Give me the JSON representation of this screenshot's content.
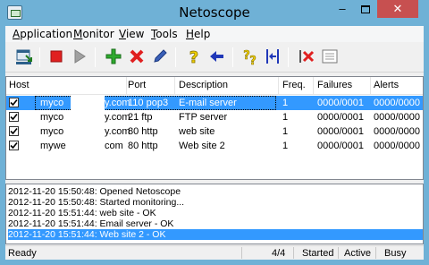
{
  "window": {
    "title": "Netoscope",
    "minimize_glyph": "–",
    "close_glyph": "✕"
  },
  "menu": {
    "items": [
      {
        "accel": "A",
        "rest": "pplication"
      },
      {
        "accel": "M",
        "rest": "onitor"
      },
      {
        "accel": "V",
        "rest": "iew"
      },
      {
        "accel": "T",
        "rest": "ools"
      },
      {
        "accel": "H",
        "rest": "elp"
      }
    ]
  },
  "toolbar": {
    "icons": [
      "import-icon",
      "stop-icon",
      "play-icon",
      "add-icon",
      "delete-icon",
      "edit-icon",
      "help-icon",
      "back-arrow-icon",
      "help-multi-icon",
      "align-icon",
      "delete-multi-icon",
      "details-icon"
    ]
  },
  "table": {
    "headers": [
      "Host",
      "Port",
      "Description",
      "Freq.",
      "Failures",
      "Alerts"
    ],
    "rows": [
      {
        "checked": true,
        "host_a": "myco",
        "host_b": "y.com",
        "port": "110 pop3",
        "description": "E-mail server",
        "freq": "1",
        "failures": "0000/0001",
        "alerts": "0000/0000",
        "selected": true
      },
      {
        "checked": true,
        "host_a": "myco",
        "host_b": "y.com",
        "port": "21 ftp",
        "description": "FTP server",
        "freq": "1",
        "failures": "0000/0001",
        "alerts": "0000/0000",
        "selected": false
      },
      {
        "checked": true,
        "host_a": "myco",
        "host_b": "y.com",
        "port": "80 http",
        "description": "web site",
        "freq": "1",
        "failures": "0000/0001",
        "alerts": "0000/0000",
        "selected": false
      },
      {
        "checked": true,
        "host_a": "mywe",
        "host_b": "com",
        "port": "80 http",
        "description": "Web site 2",
        "freq": "1",
        "failures": "0000/0001",
        "alerts": "0000/0000",
        "selected": false
      }
    ]
  },
  "log": {
    "lines": [
      "2012-11-20 15:50:48: Opened Netoscope",
      "2012-11-20 15:50:48: Started monitoring...",
      "2012-11-20 15:51:44: web site - OK",
      "2012-11-20 15:51:44: Email server - OK",
      "2012-11-20 15:51:44: Web site 2 - OK"
    ],
    "selected_index": 4
  },
  "status": {
    "state": "Ready",
    "count": "4/4",
    "monitor": "Started",
    "activity": "Active",
    "busy": "Busy"
  },
  "colors": {
    "frame": "#6fb1d6",
    "selection": "#3399ff",
    "close_button": "#c75050"
  }
}
